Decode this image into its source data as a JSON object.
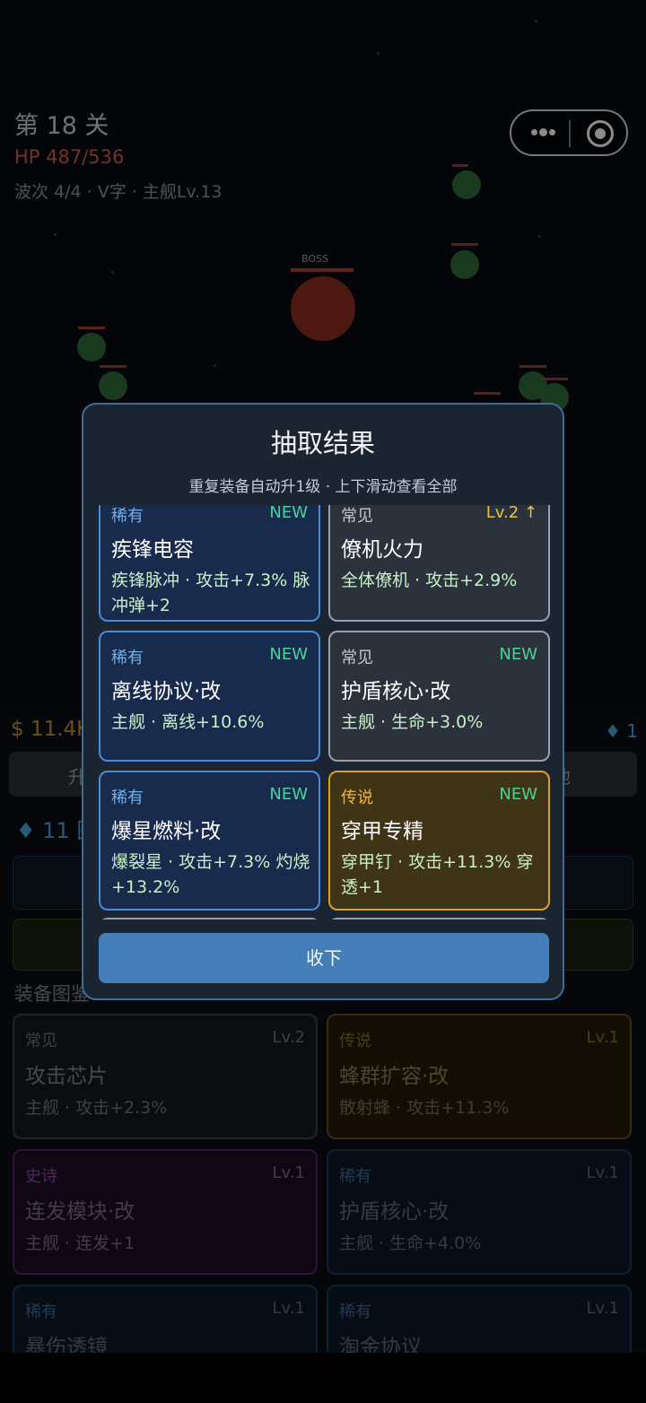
{
  "hud": {
    "stage": "第 18 关",
    "hp": "HP 487/536",
    "wave": "波次 4/4 · V字 · 主舰Lv.13",
    "boss_label": "BOSS"
  },
  "economy": {
    "money": "$ 11.4K",
    "gems_right": "♦ 1",
    "gems_left": "♦  11 图",
    "btn_left_partial": "升",
    "btn_right_partial": "池"
  },
  "dex": {
    "title": "装备图鉴",
    "cards": [
      {
        "rarity": "常见",
        "level": "Lv.2",
        "name": "攻击芯片",
        "effect": "主舰 · 攻击+2.3%"
      },
      {
        "rarity": "传说",
        "level": "Lv.1",
        "name": "蜂群扩容·改",
        "effect": "散射蜂 · 攻击+11.3%"
      },
      {
        "rarity": "史诗",
        "level": "Lv.1",
        "name": "连发模块·改",
        "effect": "主舰 · 连发+1"
      },
      {
        "rarity": "稀有",
        "level": "Lv.1",
        "name": "护盾核心·改",
        "effect": "主舰 · 生命+4.0%"
      },
      {
        "rarity": "稀有",
        "level": "Lv.1",
        "name": "暴伤透镜",
        "effect": ""
      },
      {
        "rarity": "稀有",
        "level": "Lv.1",
        "name": "淘金协议",
        "effect": ""
      }
    ]
  },
  "modal": {
    "title": "抽取结果",
    "subtitle": "重复装备自动升1级 · 上下滑动查看全部",
    "collect": "收下",
    "cards": [
      {
        "rarity": "稀有",
        "tag": "NEW",
        "name": "疾锋电容",
        "effect": "疾锋脉冲 · 攻击+7.3% 脉冲弹+2"
      },
      {
        "rarity": "常见",
        "tag": "Lv.2 ↑",
        "name": "僚机火力",
        "effect": "全体僚机 · 攻击+2.9%"
      },
      {
        "rarity": "稀有",
        "tag": "NEW",
        "name": "离线协议·改",
        "effect": "主舰 · 离线+10.6%"
      },
      {
        "rarity": "常见",
        "tag": "NEW",
        "name": "护盾核心·改",
        "effect": "主舰 · 生命+3.0%"
      },
      {
        "rarity": "稀有",
        "tag": "NEW",
        "name": "爆星燃料·改",
        "effect": "爆裂星 · 攻击+7.3% 灼烧+13.2%"
      },
      {
        "rarity": "传说",
        "tag": "NEW",
        "name": "穿甲专精",
        "effect": "穿甲钉 · 攻击+11.3% 穿透+1"
      }
    ]
  },
  "colors": {
    "rare": "#4a8ad6",
    "common": "#9aa0a8",
    "legend": "#d9a12a",
    "epic": "#8b46a8",
    "new_tag": "#49d39a",
    "button": "#437eb8"
  }
}
